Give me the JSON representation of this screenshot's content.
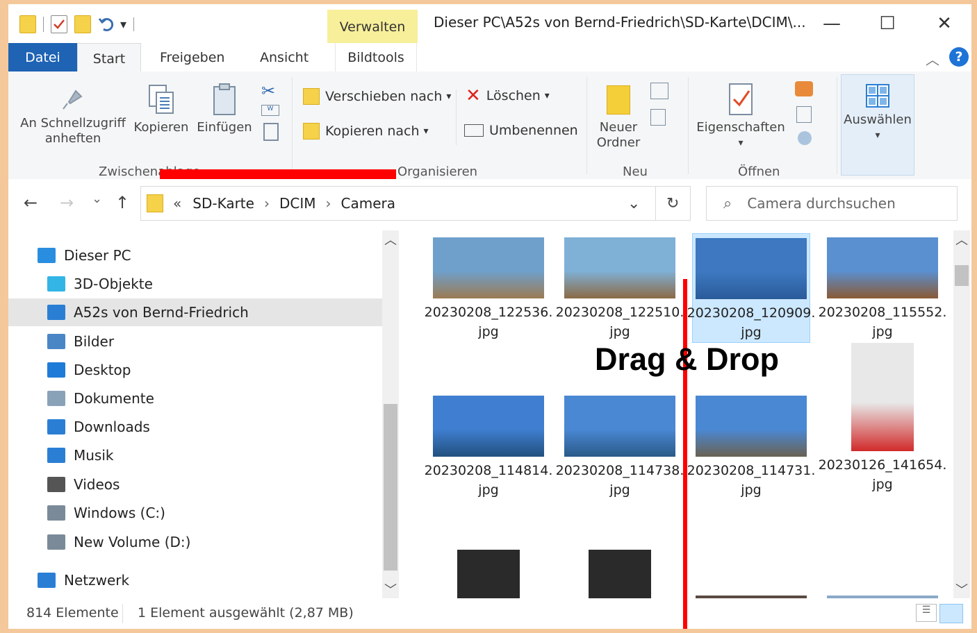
{
  "window": {
    "title": "Dieser PC\\A52s von Bernd-Friedrich\\SD-Karte\\DCIM\\...",
    "context_tab": "Verwalten",
    "controls": {
      "minimize": "—",
      "maximize": "☐",
      "close": "✕"
    }
  },
  "tabs": {
    "datei": "Datei",
    "start": "Start",
    "freigeben": "Freigeben",
    "ansicht": "Ansicht",
    "bildtools": "Bildtools"
  },
  "ribbon": {
    "pin_line1": "An Schnellzugriff",
    "pin_line2": "anheften",
    "copy": "Kopieren",
    "paste": "Einfügen",
    "group_clipboard": "Zwischenablage",
    "move_to": "Verschieben nach",
    "copy_to": "Kopieren nach",
    "delete": "Löschen",
    "rename": "Umbenennen",
    "group_organize": "Organisieren",
    "new_folder_line1": "Neuer",
    "new_folder_line2": "Ordner",
    "group_new": "Neu",
    "properties": "Eigenschaften",
    "group_open": "Öffnen",
    "select": "Auswählen",
    "dropdown_arrow": "▾",
    "help": "?"
  },
  "nav": {
    "back": "←",
    "forward": "→",
    "recent": "⌄",
    "up": "↑",
    "overflow": "«",
    "breadcrumb": [
      "SD-Karte",
      "DCIM",
      "Camera"
    ],
    "crumb_sep": "›",
    "refresh": "↻",
    "dropdown": "⌄",
    "search_placeholder": "Camera durchsuchen"
  },
  "tree": [
    {
      "label": "Dieser PC",
      "icon": "pc-icon",
      "color": "#2a8ee0"
    },
    {
      "label": "3D-Objekte",
      "icon": "cube-icon",
      "color": "#33b5e5"
    },
    {
      "label": "A52s von Bernd-Friedrich",
      "icon": "phone-icon",
      "color": "#2a7fd4",
      "selected": true
    },
    {
      "label": "Bilder",
      "icon": "pictures-icon",
      "color": "#4a86c6"
    },
    {
      "label": "Desktop",
      "icon": "desktop-icon",
      "color": "#1f7bd8"
    },
    {
      "label": "Dokumente",
      "icon": "documents-icon",
      "color": "#8aa2b8"
    },
    {
      "label": "Downloads",
      "icon": "downloads-icon",
      "color": "#2a7fd4"
    },
    {
      "label": "Musik",
      "icon": "music-icon",
      "color": "#2a7fd4"
    },
    {
      "label": "Videos",
      "icon": "videos-icon",
      "color": "#555555"
    },
    {
      "label": "Windows (C:)",
      "icon": "drive-c-icon",
      "color": "#7a8a99"
    },
    {
      "label": "New Volume (D:)",
      "icon": "drive-d-icon",
      "color": "#7a8a99"
    },
    {
      "label": "Netzwerk",
      "icon": "network-icon",
      "color": "#2a7fd4"
    }
  ],
  "files": [
    {
      "line1": "20230208_122536.",
      "line2": "jpg",
      "thumb": "lake-shore-tree-icon",
      "colors": [
        "#6fa0cc",
        "#9b7a52"
      ]
    },
    {
      "line1": "20230208_122510.",
      "line2": "jpg",
      "thumb": "lake-shore-hut-icon",
      "colors": [
        "#7fb0d6",
        "#8b6a45"
      ]
    },
    {
      "line1": "20230208_120909.",
      "line2": "jpg",
      "thumb": "lake-tree-icon",
      "colors": [
        "#3d78c0",
        "#2a5b9a"
      ],
      "selected": true
    },
    {
      "line1": "20230208_115552.",
      "line2": "jpg",
      "thumb": "lake-reeds-icon",
      "colors": [
        "#5a8fd0",
        "#8a5a34"
      ]
    },
    {
      "line1": "20230208_114814.",
      "line2": "jpg",
      "thumb": "boathouse-icon",
      "colors": [
        "#3f7ed0",
        "#22507f"
      ]
    },
    {
      "line1": "20230208_114738.",
      "line2": "jpg",
      "thumb": "boathouse-icon",
      "colors": [
        "#4a88d4",
        "#2a5a88"
      ]
    },
    {
      "line1": "20230208_114731.",
      "line2": "jpg",
      "thumb": "boathouse-icon",
      "colors": [
        "#4a88d4",
        "#6a6252"
      ]
    },
    {
      "line1": "20230126_141654.",
      "line2": "jpg",
      "thumb": "warning-sign-icon",
      "colors": [
        "#e8e8e8",
        "#d12a2a"
      ]
    },
    {
      "thumb": "tablet-photo-icon",
      "colors": [
        "#2a2a2a",
        "#c9d3da"
      ]
    },
    {
      "thumb": "tablet-photo-icon",
      "colors": [
        "#2a2a2a",
        "#bcc6cc"
      ]
    },
    {
      "thumb": "winter-window-icon",
      "colors": [
        "#5a4a42",
        "#e6eef4"
      ]
    },
    {
      "thumb": "landscape-icon",
      "colors": [
        "#8aa9c8",
        "#3a4a3a"
      ]
    }
  ],
  "status": {
    "count": "814 Elemente",
    "selection": "1 Element ausgewählt (2,87 MB)"
  },
  "overlay": {
    "label": "Drag & Drop",
    "color": "#ff0000"
  }
}
